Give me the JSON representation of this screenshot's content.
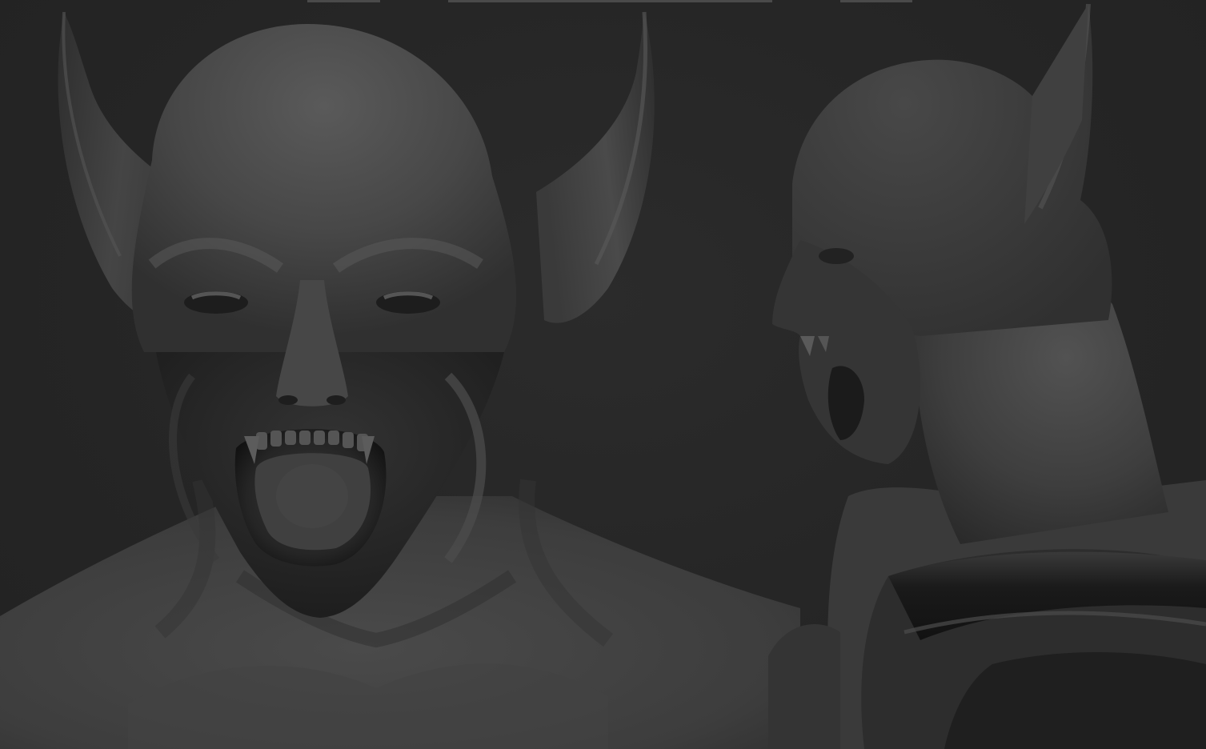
{
  "scene": {
    "description_free": true,
    "background_color": "#262626",
    "sculpt_base_color": "#3f3f3f",
    "highlight_color": "#585858",
    "shadow_color": "#141414",
    "views": [
      "front-view",
      "side-view"
    ]
  }
}
